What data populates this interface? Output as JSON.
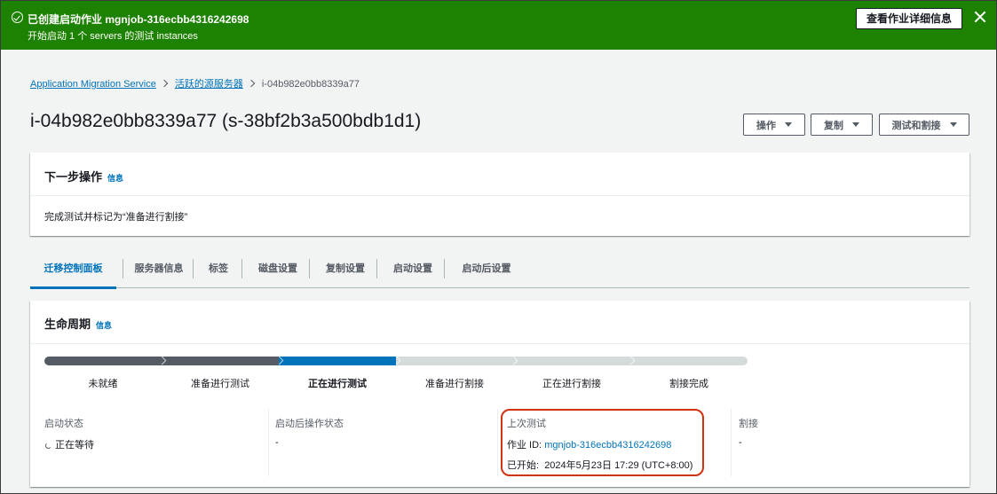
{
  "flash": {
    "title": "已创建启动作业 mgnjob-316ecbb4316242698",
    "subtitle": "开始启动 1 个 servers 的测试 instances",
    "button": "查看作业详细信息",
    "icon": "success-check-icon",
    "close_icon": "close-icon",
    "color": "#1d8102"
  },
  "breadcrumb": {
    "items": [
      "Application Migration Service",
      "活跃的源服务器",
      "i-04b982e0bb8339a77"
    ]
  },
  "header": {
    "title": "i-04b982e0bb8339a77 (s-38bf2b3a500bdb1d1)",
    "buttons": [
      "操作",
      "复制",
      "测试和割接"
    ]
  },
  "next_steps": {
    "title": "下一步操作",
    "info": "信息",
    "text": "完成测试并标记为“准备进行割接”"
  },
  "tabs": [
    "迁移控制面板",
    "服务器信息",
    "标签",
    "磁盘设置",
    "复制设置",
    "启动设置",
    "启动后设置"
  ],
  "lifecycle": {
    "title": "生命周期",
    "info": "信息",
    "steps": [
      "未就绪",
      "准备进行测试",
      "正在进行测试",
      "准备进行割接",
      "正在进行割接",
      "割接完成"
    ],
    "current_step_index": 2,
    "colors": {
      "done": "#545b64",
      "current": "#0073bb",
      "todo": "#d5dbdb"
    },
    "launch_status": {
      "label": "启动状态",
      "value": "正在等待"
    },
    "post_launch": {
      "label": "启动后操作状态",
      "value": "-"
    },
    "last_test": {
      "label": "上次测试",
      "job_label": "作业 ID:",
      "job_id": "mgnjob-316ecbb4316242698",
      "started_label": "已开始:",
      "started": "2024年5月23日 17:29 (UTC+8:00)"
    },
    "cutover": {
      "label": "割接",
      "value": "-"
    }
  }
}
